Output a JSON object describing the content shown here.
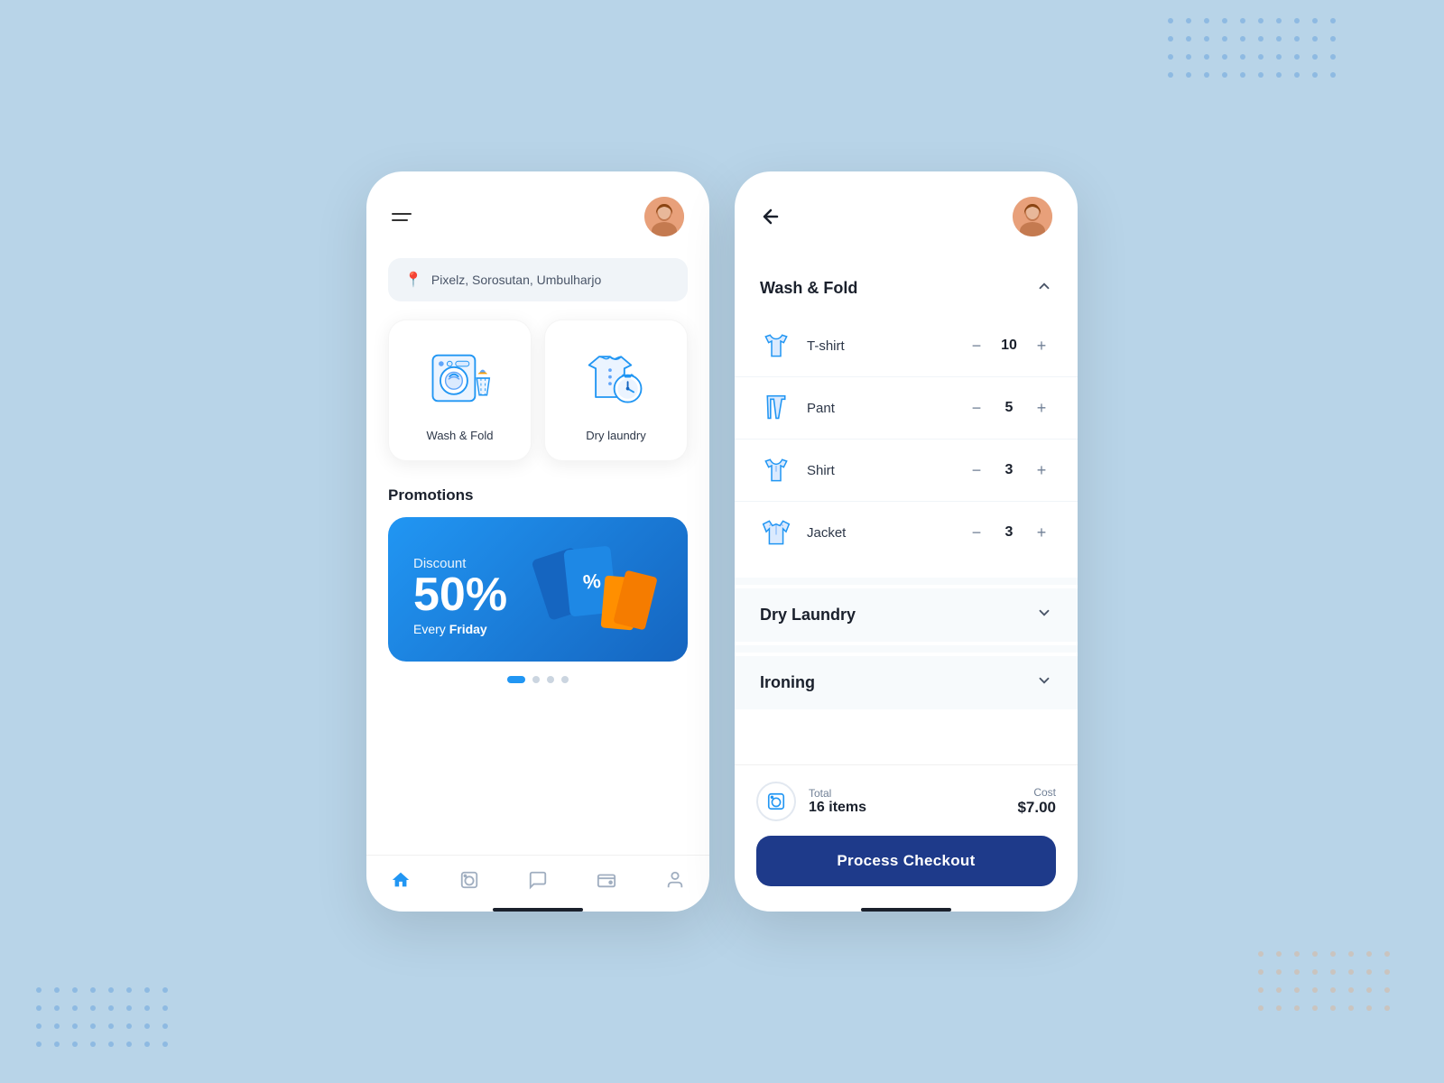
{
  "background": {
    "color": "#b8d4e8"
  },
  "phone1": {
    "location": "Pixelz, Sorosutan, Umbulharjo",
    "services": [
      {
        "id": "wash-fold",
        "label": "Wash & Fold"
      },
      {
        "id": "dry-laundry",
        "label": "Dry laundry"
      }
    ],
    "promotions_title": "Promotions",
    "promo": {
      "label": "Discount",
      "percent": "50%",
      "sub_text": "Every",
      "sub_bold": "Friday"
    },
    "nav": [
      {
        "id": "home",
        "icon": "⌂",
        "active": true
      },
      {
        "id": "laundry",
        "icon": "⊡",
        "active": false
      },
      {
        "id": "chat",
        "icon": "☉",
        "active": false
      },
      {
        "id": "wallet",
        "icon": "⊟",
        "active": false
      },
      {
        "id": "profile",
        "icon": "⊙",
        "active": false
      }
    ]
  },
  "phone2": {
    "sections": [
      {
        "id": "wash-fold",
        "title": "Wash & Fold",
        "expanded": true,
        "items": [
          {
            "id": "tshirt",
            "name": "T-shirt",
            "qty": 10
          },
          {
            "id": "pant",
            "name": "Pant",
            "qty": 5
          },
          {
            "id": "shirt",
            "name": "Shirt",
            "qty": 3
          },
          {
            "id": "jacket",
            "name": "Jacket",
            "qty": 3
          }
        ]
      },
      {
        "id": "dry-laundry",
        "title": "Dry Laundry",
        "expanded": false,
        "items": []
      },
      {
        "id": "ironing",
        "title": "Ironing",
        "expanded": false,
        "items": []
      }
    ],
    "footer": {
      "total_label": "Total",
      "total_items": "16 items",
      "cost_label": "Cost",
      "cost_value": "$7.00",
      "checkout_btn": "Process Checkout"
    }
  }
}
